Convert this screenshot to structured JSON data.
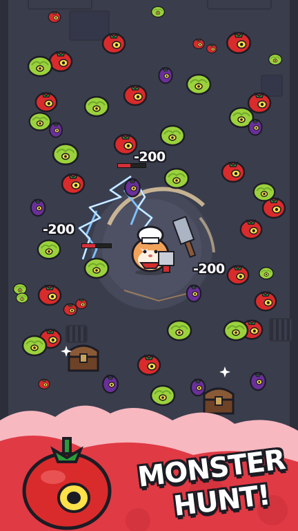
{
  "game": {
    "damage_popups": [
      "-200",
      "-200",
      "-200"
    ],
    "promo_line1": "MONSTER",
    "promo_line2": "HUNT!"
  },
  "colors": {
    "floor": "#3a3d4c",
    "banner_red": "#e03a44",
    "banner_pink": "#f7b8c0",
    "tomato": "#d92b2b",
    "cabbage": "#9bd23c",
    "eggplant": "#6a2f9a",
    "lightning": "#5aa8ff"
  },
  "characters": {
    "player": "hamster-chef",
    "enemies": [
      "tomato-monster",
      "cabbage-monster",
      "eggplant-monster"
    ],
    "pickups": [
      "treasure-chest"
    ]
  },
  "enemy_health": [
    0.45,
    0.45
  ]
}
